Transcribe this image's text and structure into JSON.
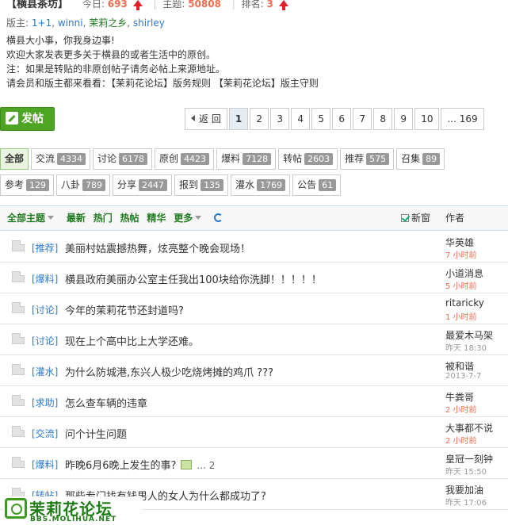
{
  "forum": {
    "name": "【横县茶坊】",
    "today_label": "今日:",
    "today_count": "693",
    "topics_label": "主题:",
    "topics_count": "50808",
    "rank_label": "排名:",
    "rank_value": "3",
    "sep": "|",
    "mods_label": "版主:",
    "mods": [
      "1+1",
      "winni",
      "茉莉之乡",
      "shirley"
    ],
    "mods_sep": ",",
    "desc_lines": [
      "横县大小事，你我身边事!",
      "欢迎大家发表更多关于横县的或者生活中的原创。",
      "注：如果是转贴的非原创帖子请务必帖上来源地址。",
      "请会员和版主都来看看：【茉莉花论坛】版务规则 【茉莉花论坛】版主守则"
    ]
  },
  "post_button": "发帖",
  "pager": {
    "back": "返 回",
    "pages": [
      "1",
      "2",
      "3",
      "4",
      "5",
      "6",
      "7",
      "8",
      "9",
      "10"
    ],
    "last": "... 169"
  },
  "types": [
    [
      {
        "label": "全部",
        "count": ""
      },
      {
        "label": "交流",
        "count": "4334"
      },
      {
        "label": "讨论",
        "count": "6178"
      },
      {
        "label": "原创",
        "count": "4423"
      },
      {
        "label": "爆料",
        "count": "7128"
      },
      {
        "label": "转帖",
        "count": "2603"
      },
      {
        "label": "推荐",
        "count": "575"
      },
      {
        "label": "召集",
        "count": "89"
      }
    ],
    [
      {
        "label": "参考",
        "count": "129"
      },
      {
        "label": "八卦",
        "count": "789"
      },
      {
        "label": "分享",
        "count": "2447"
      },
      {
        "label": "报到",
        "count": "135"
      },
      {
        "label": "灌水",
        "count": "1769"
      },
      {
        "label": "公告",
        "count": "61"
      }
    ]
  ],
  "list_head": {
    "all_topics": "全部主题",
    "latest": "最新",
    "hot": "热门",
    "hot2": "热帖",
    "digest": "精华",
    "more": "更多",
    "new_window": "新窗",
    "author": "作者"
  },
  "threads": [
    {
      "cat": "[推荐]",
      "subject": "美丽村姑震撼热舞，炫亮整个晚会现场！",
      "author": "华英雄",
      "time": "7 小时前",
      "recent": true
    },
    {
      "cat": "[爆料]",
      "subject": "横县政府美丽办公室主任我出100块给你洗脚！！！！！",
      "author": "小道消息",
      "time": "5 小时前",
      "recent": true
    },
    {
      "cat": "[讨论]",
      "subject": "今年的茉莉花节还封道吗?",
      "author": "ritaricky",
      "time": "1 小时前",
      "recent": true
    },
    {
      "cat": "[讨论]",
      "subject": "现在上个高中比上大学还难。",
      "author": "最爱木马架",
      "time": "昨天 18:30",
      "recent": false
    },
    {
      "cat": "[灌水]",
      "subject": "为什么防城港,东兴人极少吃烧烤摊的鸡爪 ???",
      "author": "被和谐",
      "time": "2013-7-7",
      "recent": false
    },
    {
      "cat": "[求助]",
      "subject": "怎么查车辆的违章",
      "author": "牛粪哥",
      "time": "2 小时前",
      "recent": true
    },
    {
      "cat": "[交流]",
      "subject": "问个计生问题",
      "author": "大事都不说",
      "time": "2 小时前",
      "recent": true
    },
    {
      "cat": "[爆料]",
      "subject": "昨晚6月6晚上发生的事?",
      "attach": true,
      "pages": "... 2",
      "author": "皇冠一刻钟",
      "time": "昨天 15:50",
      "recent": false
    },
    {
      "cat": "[转帖]",
      "subject": "那些专门找有钱男人的女人为什么都成功了?",
      "author": "我要加油",
      "time": "昨天 17:06",
      "recent": false
    }
  ],
  "logo": {
    "name": "茉莉花论坛",
    "url": "BBS.MOLIHUA.NET"
  },
  "colors": {
    "accent_green": "#4ea523",
    "link_blue": "#2b7acd",
    "hot_number": "#f26c4f",
    "up_arrow": "#e5202a"
  }
}
